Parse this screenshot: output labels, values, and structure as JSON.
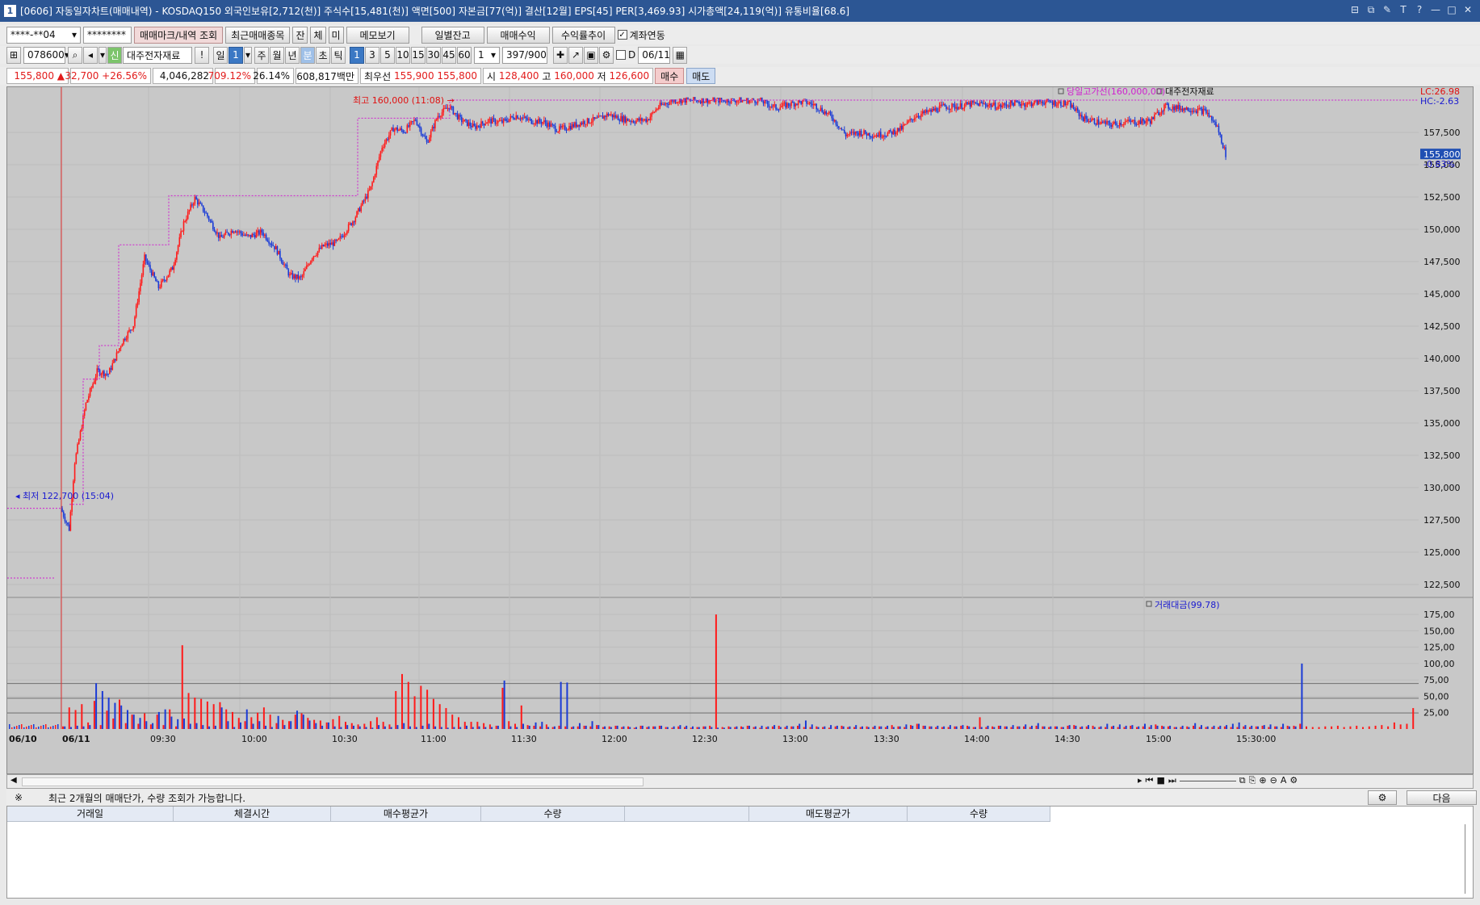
{
  "window": {
    "app_num": "1",
    "title": "[0606] 자동일자차트(매매내역) - KOSDAQ150 외국인보유[2,712(천)] 주식수[15,481(천)] 액면[500] 자본금[77(억)] 결산[12월] EPS[45] PER[3,469.93] 시가총액[24,119(억)] 유통비율[68.6]"
  },
  "toolbar1": {
    "account": "****-**04",
    "password": "********",
    "btn_trade_mark": "매매마크/내역 조회",
    "btn_recent": "최근매매종목",
    "btn_jan": "잔",
    "btn_che": "체",
    "btn_mi": "미",
    "btn_memo": "메모보기",
    "btn_daily": "일별잔고",
    "btn_profit": "매매수익",
    "btn_rate": "수익률추이",
    "link_label": "계좌연동"
  },
  "toolbar2": {
    "code": "078600",
    "stock_name": "대주전자재료",
    "excl": "!",
    "periods": [
      "일",
      "1",
      "주",
      "월",
      "년",
      "분",
      "초",
      "틱"
    ],
    "intervals": [
      "1",
      "3",
      "5",
      "10",
      "15",
      "30",
      "45",
      "60"
    ],
    "count": "1",
    "range": "397/900",
    "d_label": "D",
    "date": "06/11"
  },
  "pricebar": {
    "price": "155,800 ▲",
    "change": "32,700 +26.56%",
    "volume": "4,046,282",
    "vol_ratio": "709.12%",
    "turnover": "26.14%",
    "amount": "608,817백만",
    "best_label": "최우선",
    "best_prices": "155,900 155,800",
    "open_label": "시",
    "open": "128,400",
    "high_label": "고",
    "high": "160,000",
    "low_label": "저",
    "low": "126,600",
    "buy_btn": "매수",
    "sell_btn": "매도"
  },
  "chart_data": {
    "type": "candlestick",
    "x_ticks": [
      "06/10",
      "06/11",
      "09:30",
      "10:00",
      "10:30",
      "11:00",
      "11:30",
      "12:00",
      "12:30",
      "13:00",
      "13:30",
      "14:00",
      "14:30",
      "15:00",
      "15:30:00"
    ],
    "price_axis": {
      "ticks": [
        "157,500",
        "155,000",
        "152,500",
        "150,000",
        "147,500",
        "145,000",
        "142,500",
        "140,000",
        "137,500",
        "135,000",
        "132,500",
        "130,000",
        "127,500",
        "125,000",
        "122,500"
      ],
      "ylim": [
        121500,
        161000
      ]
    },
    "volume_axis": {
      "ticks": [
        "175,00",
        "150,00",
        "125,00",
        "100,00",
        "75,00",
        "50,00",
        "25,00"
      ],
      "ylim": [
        0,
        187.5
      ]
    },
    "annotations": {
      "high": "최고 160,000 (11:08)",
      "low": "최저 122,700 (15:04)",
      "legend_high": "당일고가선(160,000,00)",
      "legend_name": "대주전자재료",
      "lc": "LC:26.98",
      "hc": "HC:-2.63",
      "last_price": "155,800",
      "last_pct": "-0.83%",
      "volume_legend": "거래대금(99.78)"
    },
    "price_path": [
      [
        0,
        128400
      ],
      [
        6,
        126800
      ],
      [
        10,
        132000
      ],
      [
        18,
        136500
      ],
      [
        26,
        139000
      ],
      [
        34,
        138800
      ],
      [
        44,
        141300
      ],
      [
        52,
        142600
      ],
      [
        60,
        147800
      ],
      [
        70,
        145500
      ],
      [
        80,
        147000
      ],
      [
        88,
        150500
      ],
      [
        96,
        152400
      ],
      [
        104,
        151200
      ],
      [
        114,
        149300
      ],
      [
        124,
        150000
      ],
      [
        134,
        149400
      ],
      [
        144,
        149800
      ],
      [
        154,
        148500
      ],
      [
        164,
        146400
      ],
      [
        172,
        146200
      ],
      [
        180,
        147900
      ],
      [
        188,
        148700
      ],
      [
        198,
        149000
      ],
      [
        210,
        150800
      ],
      [
        222,
        153200
      ],
      [
        230,
        156400
      ],
      [
        238,
        157800
      ],
      [
        246,
        157600
      ],
      [
        254,
        158500
      ],
      [
        262,
        156700
      ],
      [
        270,
        158800
      ],
      [
        278,
        159500
      ],
      [
        286,
        158500
      ],
      [
        296,
        157900
      ],
      [
        306,
        158400
      ],
      [
        316,
        158300
      ],
      [
        326,
        158800
      ],
      [
        336,
        158400
      ],
      [
        346,
        158300
      ],
      [
        356,
        157700
      ],
      [
        366,
        158000
      ],
      [
        374,
        158300
      ],
      [
        384,
        158500
      ],
      [
        392,
        158900
      ],
      [
        400,
        158600
      ],
      [
        410,
        158400
      ],
      [
        420,
        158500
      ],
      [
        428,
        159500
      ],
      [
        438,
        160000
      ],
      [
        442,
        160000
      ],
      [
        500,
        160000
      ],
      [
        512,
        159400
      ],
      [
        522,
        159700
      ],
      [
        532,
        159900
      ],
      [
        540,
        159600
      ],
      [
        552,
        158700
      ],
      [
        562,
        157300
      ],
      [
        572,
        157500
      ],
      [
        582,
        157300
      ],
      [
        592,
        157400
      ],
      [
        602,
        157800
      ],
      [
        612,
        158800
      ],
      [
        622,
        159100
      ],
      [
        632,
        159500
      ],
      [
        642,
        159500
      ],
      [
        652,
        159700
      ],
      [
        662,
        159700
      ],
      [
        672,
        159500
      ],
      [
        682,
        159800
      ],
      [
        692,
        159700
      ],
      [
        702,
        159900
      ],
      [
        712,
        159800
      ],
      [
        722,
        159700
      ],
      [
        732,
        158600
      ],
      [
        742,
        158300
      ],
      [
        752,
        158100
      ],
      [
        762,
        158300
      ],
      [
        770,
        158300
      ],
      [
        780,
        158400
      ],
      [
        790,
        159500
      ],
      [
        800,
        159400
      ],
      [
        810,
        159300
      ],
      [
        820,
        159100
      ],
      [
        828,
        157900
      ],
      [
        834,
        155800
      ]
    ],
    "volume_series": [
      {
        "name": "상승",
        "color": "#ff0000",
        "values": [
          4,
          33,
          29,
          38,
          10,
          43,
          6,
          28,
          16,
          45,
          9,
          22,
          8,
          24,
          7,
          22,
          6,
          30,
          4,
          128,
          55,
          48,
          46,
          42,
          38,
          41,
          30,
          26,
          17,
          12,
          18,
          25,
          33,
          22,
          9,
          14,
          12,
          22,
          24,
          17,
          14,
          13,
          10,
          15,
          20,
          11,
          9,
          7,
          8,
          12,
          18,
          11,
          7,
          58,
          84,
          72,
          50,
          66,
          60,
          46,
          38,
          32,
          22,
          18,
          11,
          11,
          11,
          9,
          7,
          5,
          63,
          12,
          8,
          36,
          6,
          5,
          4,
          7,
          3,
          5,
          4,
          3,
          4,
          5,
          4,
          6,
          3,
          4,
          5,
          3,
          4,
          2,
          5,
          3,
          4,
          5,
          3,
          2,
          4,
          3,
          2,
          3,
          4,
          5,
          175,
          3,
          4,
          3,
          4,
          5,
          3,
          2,
          3,
          4,
          5,
          3,
          4,
          5,
          3,
          3,
          4,
          3,
          2,
          4,
          5,
          3,
          3,
          3,
          4,
          3,
          4,
          3,
          6,
          4,
          3,
          6,
          8,
          5,
          4,
          3,
          3,
          3,
          4,
          5,
          5,
          3,
          18,
          3,
          4,
          5,
          4,
          3,
          4,
          4,
          3,
          5,
          4,
          3,
          4,
          3,
          5,
          6,
          3,
          4,
          5,
          3,
          3,
          4,
          3,
          3,
          5,
          3,
          4,
          3,
          7,
          5,
          4,
          3,
          3,
          4,
          5,
          3,
          3,
          3,
          3,
          4,
          3,
          3,
          4,
          3,
          4,
          5,
          3,
          4,
          3,
          5,
          5,
          8,
          4,
          3,
          3,
          4,
          4,
          5,
          3,
          4,
          5,
          3,
          4,
          5,
          6,
          4,
          10,
          7,
          8,
          32
        ]
      },
      {
        "name": "하락",
        "color": "#1a1ad0",
        "values": [
          4,
          3,
          5,
          4,
          6,
          70,
          58,
          48,
          40,
          36,
          29,
          22,
          17,
          12,
          9,
          26,
          30,
          19,
          15,
          16,
          8,
          9,
          6,
          4,
          5,
          33,
          12,
          3,
          10,
          30,
          8,
          12,
          5,
          3,
          20,
          6,
          12,
          28,
          22,
          13,
          9,
          5,
          10,
          4,
          3,
          6,
          5,
          4,
          3,
          2,
          6,
          4,
          3,
          6,
          9,
          4,
          3,
          5,
          8,
          4,
          3,
          2,
          3,
          3,
          5,
          3,
          4,
          3,
          3,
          5,
          74,
          4,
          3,
          8,
          5,
          10,
          11,
          3,
          4,
          72,
          71,
          4,
          9,
          5,
          12,
          6,
          4,
          3,
          5,
          4,
          3,
          3,
          5,
          4,
          4,
          5,
          3,
          4,
          6,
          5,
          4,
          3,
          4,
          3,
          2,
          2,
          3,
          4,
          3,
          5,
          4,
          5,
          4,
          6,
          3,
          5,
          4,
          8,
          13,
          7,
          3,
          4,
          6,
          5,
          4,
          4,
          6,
          4,
          3,
          5,
          4,
          5,
          3,
          4,
          7,
          5,
          8,
          5,
          4,
          5,
          4,
          6,
          4,
          6,
          4,
          3,
          3,
          5,
          3,
          5,
          4,
          6,
          4,
          7,
          5,
          9,
          4,
          4,
          4,
          3,
          6,
          5,
          4,
          6,
          3,
          4,
          8,
          5,
          7,
          5,
          6,
          4,
          8,
          6,
          5,
          4,
          5,
          3,
          5,
          3,
          9,
          6,
          4,
          5,
          5,
          6,
          8,
          10,
          6,
          5,
          4,
          6,
          7,
          4,
          8,
          4,
          4,
          100
        ]
      }
    ]
  },
  "bottom": {
    "notice_mark": "※",
    "notice": "최근 2개월의 매매단가, 수량 조회가 가능합니다.",
    "next_btn": "다음",
    "columns": [
      "거래일",
      "체결시간",
      "매수평균가",
      "수량",
      "",
      "매도평균가",
      "수량"
    ]
  }
}
